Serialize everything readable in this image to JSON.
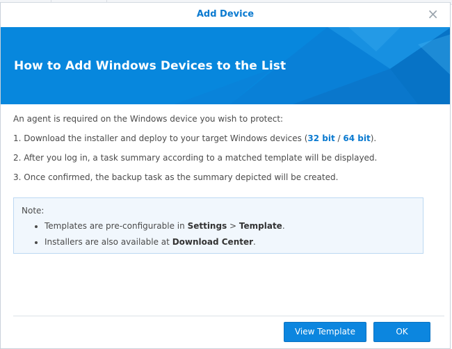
{
  "dialog": {
    "title": "Add Device",
    "close_symbol": "×"
  },
  "banner": {
    "heading": "How to Add Windows Devices to the List",
    "colors": {
      "base": "#0787dd",
      "accent_dark": "#0568b8",
      "accent_light": "#2ba4ee"
    }
  },
  "content": {
    "intro": "An agent is required on the Windows device you wish to protect:",
    "step1_prefix": "1. Download the installer and deploy to your target Windows devices (",
    "step1_link32": "32 bit",
    "step1_sep": " / ",
    "step1_link64": "64 bit",
    "step1_suffix": ").",
    "step2": "2. After you log in, a task summary according to a matched template will be displayed.",
    "step3": "3. Once confirmed, the backup task as the summary depicted will be created."
  },
  "note": {
    "label": "Note:",
    "item1_prefix": "Templates are pre-configurable in ",
    "item1_settings": "Settings",
    "item1_sep": " > ",
    "item1_template": "Template",
    "item1_suffix": ".",
    "item2_prefix": "Installers are also available at ",
    "item2_download": "Download Center",
    "item2_suffix": "."
  },
  "buttons": {
    "view_template": "View Template",
    "ok": "OK"
  },
  "icons": {
    "close": "close-icon"
  }
}
